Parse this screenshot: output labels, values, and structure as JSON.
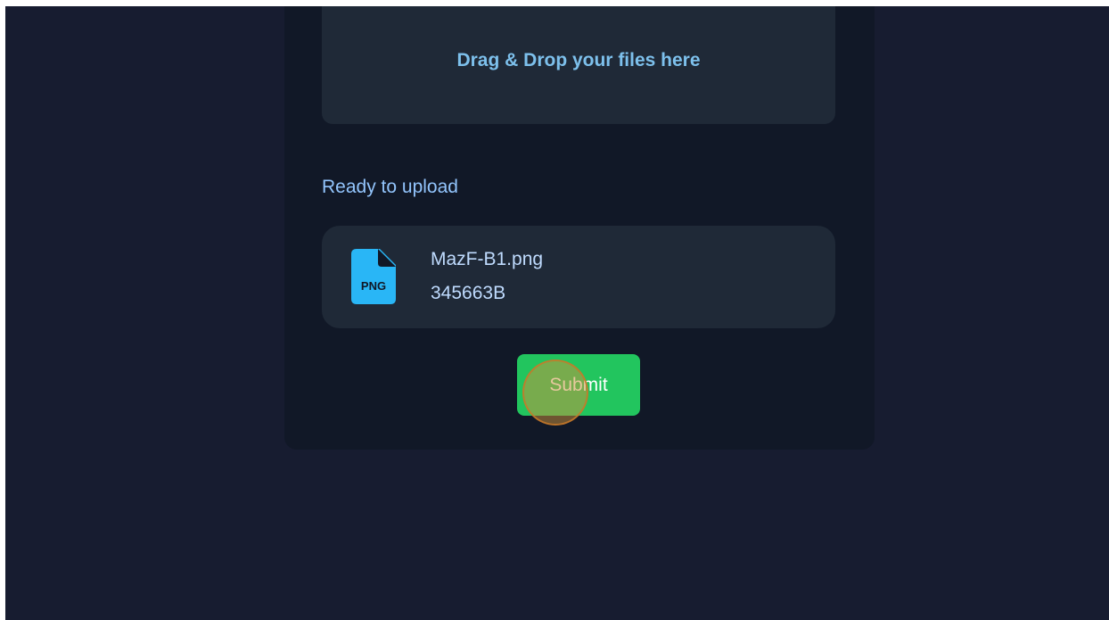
{
  "dropzone": {
    "icon": "cloud-upload-icon",
    "text": "Drag & Drop your files here"
  },
  "status": {
    "text": "Ready to upload"
  },
  "files": [
    {
      "icon": "png-file-icon",
      "icon_label": "PNG",
      "name": "MazF-B1.png",
      "size": "345663B"
    }
  ],
  "submit": {
    "label": "Submit"
  },
  "colors": {
    "page_background": "#171c30",
    "card_background": "#111827",
    "panel_background": "#1f2937",
    "accent_text": "#7dc0ec",
    "submit_green": "#22c55e",
    "file_icon_blue": "#29b6f6"
  }
}
